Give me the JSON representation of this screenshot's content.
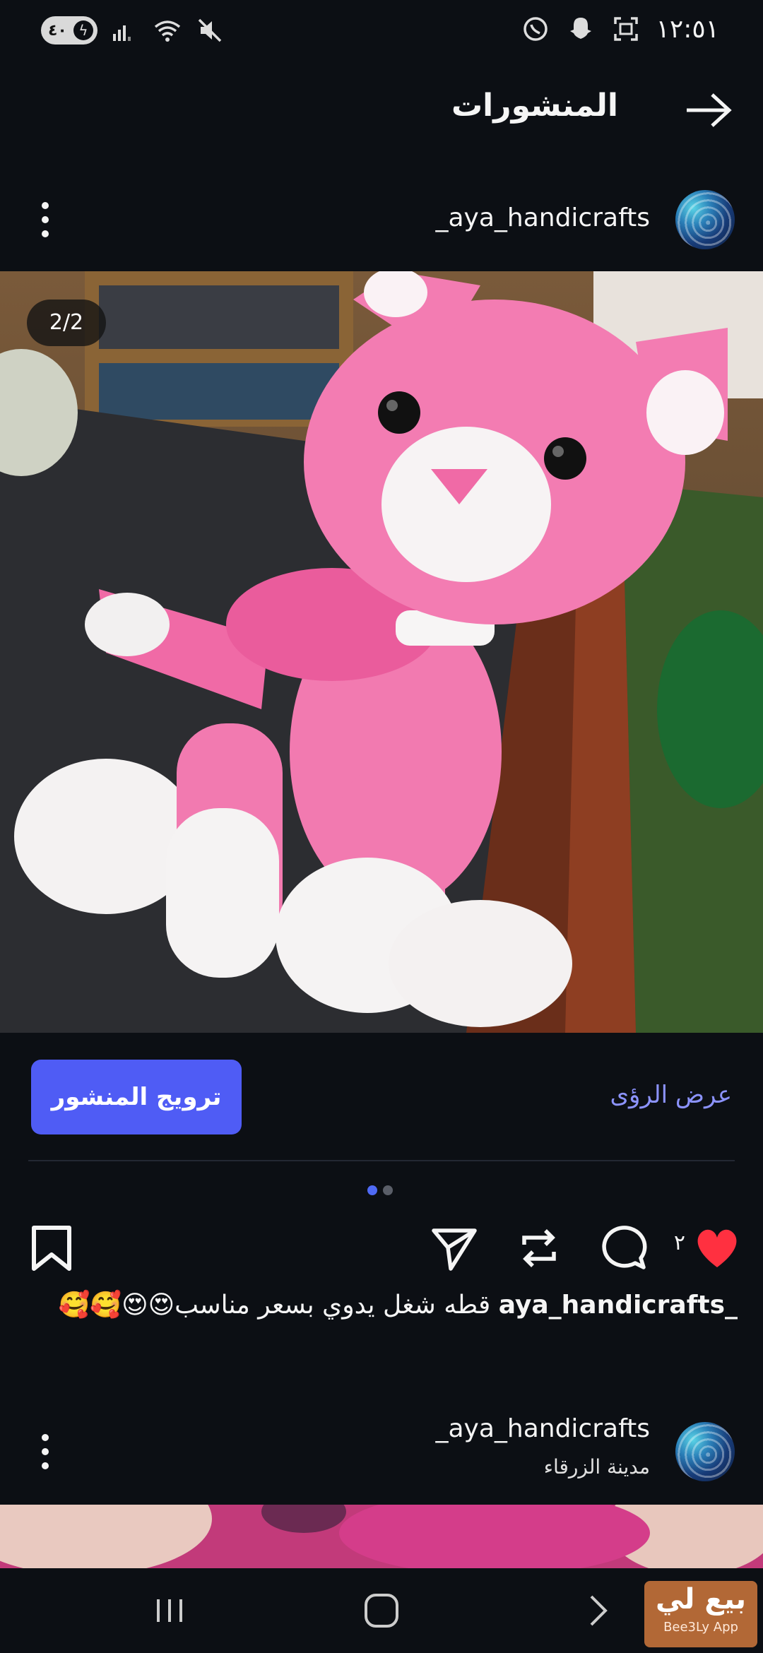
{
  "status_bar": {
    "battery": "٤٠",
    "time": "١٢:٥١"
  },
  "header": {
    "title": "المنشورات"
  },
  "post": {
    "username": "_aya_handicrafts",
    "counter": "2/2",
    "promote_label": "ترويج المنشور",
    "insights_label": "عرض الرؤى",
    "likes": "٢",
    "caption_user": "_aya_handicrafts",
    "caption_text": "قطه شغل يدوي بسعر مناسب😍😍🥰🥰"
  },
  "next_post": {
    "username": "_aya_handicrafts",
    "location": "مدينة الزرقاء"
  },
  "watermark": {
    "arabic": "بيع لي",
    "english": "Bee3Ly App"
  },
  "colors": {
    "background": "#0c0f14",
    "accent": "#4f5cf5",
    "link": "#8c93ff",
    "like": "#ff3040"
  }
}
